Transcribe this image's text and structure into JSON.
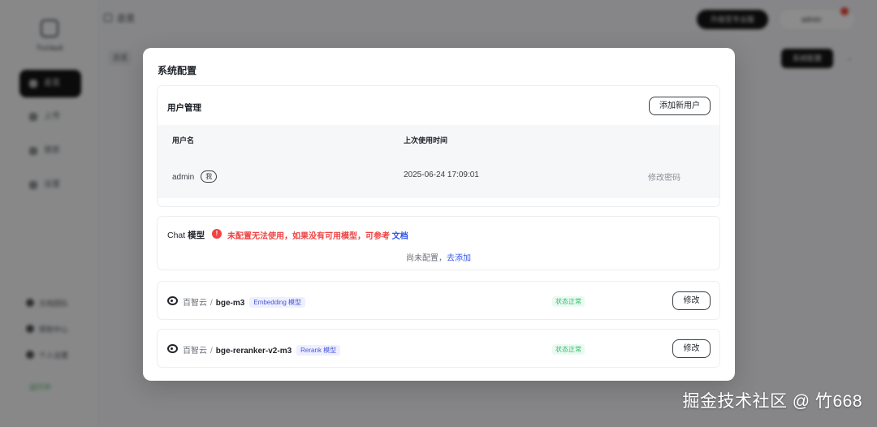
{
  "background": {
    "brand": "TruVault",
    "nav": [
      "总览",
      "上传",
      "搜索",
      "设置"
    ],
    "footer": [
      "文档团队",
      "帮助中心",
      "个人设置"
    ],
    "status": "运行中",
    "breadcrumb": "总览",
    "header_pill": "升级至专业版",
    "user": "admin",
    "tab": "总览",
    "action": "系统配置"
  },
  "modal": {
    "title": "系统配置",
    "users_section": {
      "title": "用户管理",
      "add_button": "添加新用户",
      "columns": [
        "用户名",
        "上次使用时间"
      ],
      "rows": [
        {
          "username": "admin",
          "me_badge": "我",
          "last_used": "2025-06-24 17:09:01",
          "action": "修改密码"
        }
      ]
    },
    "chat_section": {
      "title_prefix": "Chat",
      "title_suffix": "模型",
      "warning": "未配置无法使用，如果没有可用模型，可参考",
      "warning_link": "文档",
      "empty_text": "尚未配置，",
      "empty_link": "去添加"
    },
    "models": [
      {
        "provider": "百智云",
        "name": "bge-m3",
        "tag": "Embedding 模型",
        "status": "状态正常",
        "edit": "修改"
      },
      {
        "provider": "百智云",
        "name": "bge-reranker-v2-m3",
        "tag": "Rerank 模型",
        "status": "状态正常",
        "edit": "修改"
      }
    ]
  },
  "watermark": "掘金技术社区 @ 竹668",
  "colors": {
    "warning": "#ef4444",
    "link": "#2f54eb",
    "ok": "#2ebd6b",
    "tag": "#4a56d6"
  }
}
